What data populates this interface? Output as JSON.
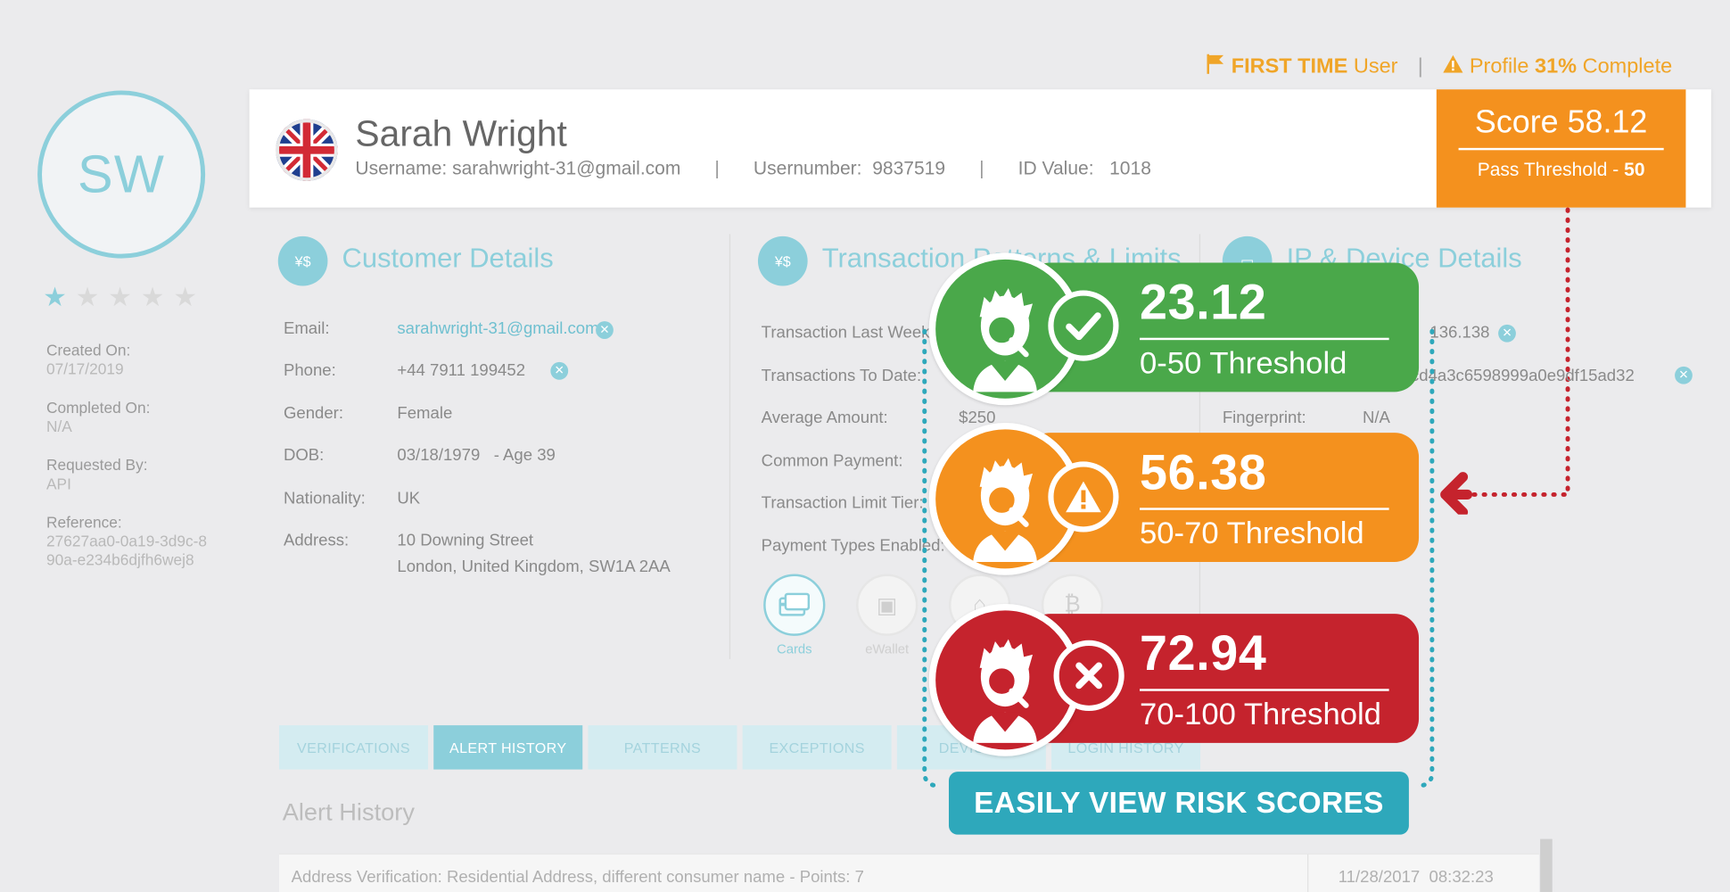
{
  "status": {
    "first_time_bold": "FIRST TIME",
    "first_time_rest": "User",
    "separator": "|",
    "profile_prefix": "Profile",
    "profile_pct": "31%",
    "profile_suffix": "Complete"
  },
  "avatar": {
    "initials": "SW",
    "rating": 1,
    "rating_max": 5
  },
  "meta": [
    {
      "label": "Created On:",
      "value": "07/17/2019"
    },
    {
      "label": "Completed On:",
      "value": "N/A"
    },
    {
      "label": "Requested By:",
      "value": "API"
    },
    {
      "label": "Reference:",
      "value": "27627aa0-0a19-3d9c-8",
      "value2": "90a-e234b6djfh6wej8"
    }
  ],
  "header": {
    "name": "Sarah Wright",
    "username_label": "Username:",
    "username": "sarahwright-31@gmail.com",
    "usernumber_label": "Usernumber:",
    "usernumber": "9837519",
    "idvalue_label": "ID Value:",
    "idvalue": "1018",
    "sep": "|"
  },
  "score": {
    "label": "Score 58.12",
    "threshold_label": "Pass Threshold -",
    "threshold": "50"
  },
  "customer": {
    "title": "Customer Details",
    "rows": [
      {
        "label": "Email:",
        "value": "sarahwright-31@gmail.com"
      },
      {
        "label": "Phone:",
        "value": "+44 7911 199452"
      },
      {
        "label": "Gender:",
        "value": "Female"
      },
      {
        "label": "DOB:",
        "value": "03/18/1979   - Age 39"
      },
      {
        "label": "Nationality:",
        "value": "UK"
      },
      {
        "label": "Address:",
        "value": "10 Downing Street",
        "value2": "London, United Kingdom, SW1A 2AA"
      }
    ]
  },
  "transactions": {
    "title": "Transaction Patterns & Limits",
    "rows": [
      {
        "label": "Transaction Last Week:"
      },
      {
        "label": "Transactions To Date:"
      },
      {
        "label": "Average Amount:",
        "value": "$250"
      },
      {
        "label": "Common Payment:"
      },
      {
        "label": "Transaction Limit Tier:"
      },
      {
        "label": "Payment Types Enabled:"
      }
    ],
    "payment_types": [
      "Cards",
      "eWallet",
      "",
      ""
    ]
  },
  "ip": {
    "title": "IP & Device Details",
    "ip_value": "136.138",
    "hash_value": "e6cd4a3c6598999a0e9df15ad32",
    "fingerprint_label": "Fingerprint:",
    "fingerprint_value": "N/A"
  },
  "tabs": [
    "VERIFICATIONS",
    "ALERT HISTORY",
    "PATTERNS",
    "EXCEPTIONS",
    "DEVICES",
    "LOGIN HISTORY"
  ],
  "active_tab": 1,
  "alert_history": {
    "title": "Alert History",
    "row_text": "Address Verification: Residential Address, different consumer name - Points: 7",
    "row_date": "11/28/2017  08:32:23"
  },
  "risk_cards": [
    {
      "score": "23.12",
      "threshold": "0-50 Threshold",
      "color": "#4aa84a",
      "status": "check-icon"
    },
    {
      "score": "56.38",
      "threshold": "50-70 Threshold",
      "color": "#f4911e",
      "status": "warning-icon"
    },
    {
      "score": "72.94",
      "threshold": "70-100 Threshold",
      "color": "#c5232d",
      "status": "cross-icon"
    }
  ],
  "cta": "EASILY VIEW RISK SCORES",
  "colors": {
    "accent": "#8ccfdb",
    "orange": "#f4911e",
    "green": "#4aa84a",
    "red": "#c5232d",
    "cta": "#2ea8bb"
  }
}
